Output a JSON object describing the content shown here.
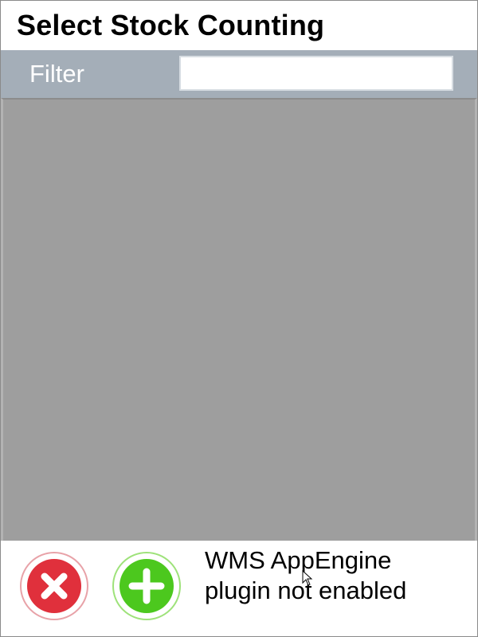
{
  "title": "Select Stock Counting",
  "filter": {
    "label": "Filter",
    "value": "",
    "placeholder": ""
  },
  "list": {
    "items": []
  },
  "footer": {
    "cancel_icon": "close-icon",
    "add_icon": "plus-icon",
    "status_line1": "WMS AppEngine",
    "status_line2": "plugin not enabled"
  },
  "colors": {
    "filter_bar": "#a4aeb8",
    "list_background": "#9e9e9e",
    "cancel_red": "#e0303c",
    "add_green": "#4cc81e"
  }
}
